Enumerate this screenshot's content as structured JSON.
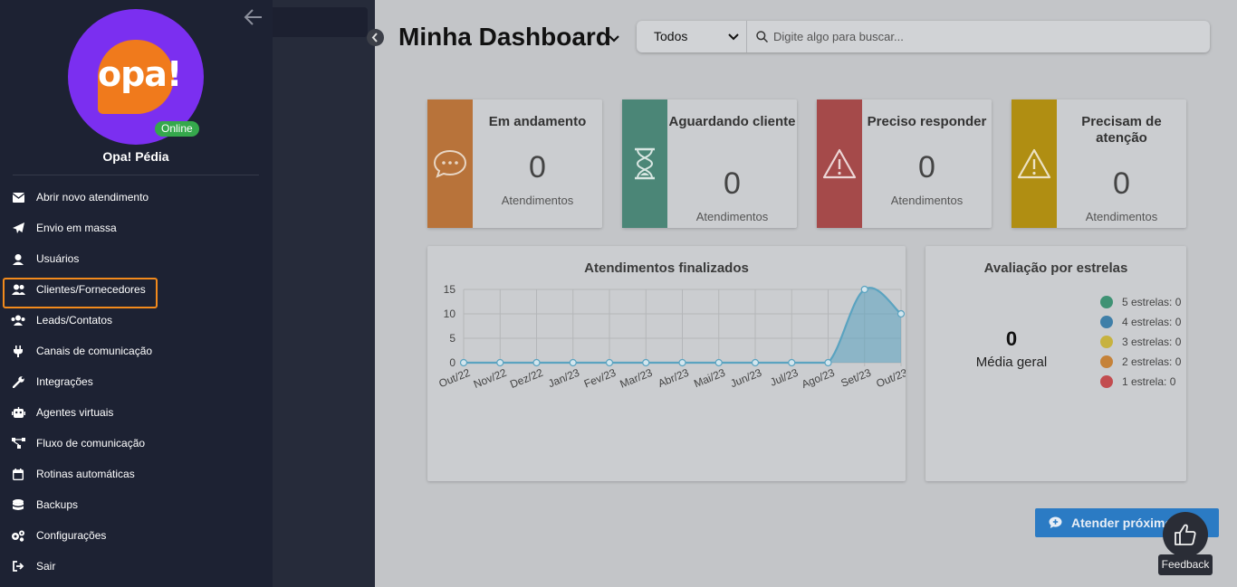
{
  "sidebar": {
    "user_name": "Opa! Pédia",
    "status": "Online",
    "logo_text": "opa!",
    "items": [
      {
        "label": "Abrir novo atendimento",
        "icon": "envelope-icon"
      },
      {
        "label": "Envio em massa",
        "icon": "paper-plane-icon"
      },
      {
        "label": "Usuários",
        "icon": "user-headset-icon"
      },
      {
        "label": "Clientes/Fornecedores",
        "icon": "users-icon",
        "selected": true
      },
      {
        "label": "Leads/Contatos",
        "icon": "user-group-icon"
      },
      {
        "label": "Canais de comunicação",
        "icon": "plug-icon"
      },
      {
        "label": "Integrações",
        "icon": "wrench-icon"
      },
      {
        "label": "Agentes virtuais",
        "icon": "robot-icon"
      },
      {
        "label": "Fluxo de comunicação",
        "icon": "flow-icon"
      },
      {
        "label": "Rotinas automáticas",
        "icon": "calendar-icon"
      },
      {
        "label": "Backups",
        "icon": "database-icon"
      },
      {
        "label": "Configurações",
        "icon": "gears-icon"
      },
      {
        "label": "Sair",
        "icon": "sign-out-icon"
      }
    ]
  },
  "header": {
    "title": "Minha Dashboard",
    "filter_value": "Todos",
    "search_placeholder": "Digite algo para buscar..."
  },
  "cards": [
    {
      "title": "Em andamento",
      "value": "0",
      "label": "Atendimentos",
      "color": "#b8733a",
      "icon": "chat-bubble-icon"
    },
    {
      "title": "Aguardando cliente",
      "value": "0",
      "label": "Atendimentos",
      "color": "#4b8677",
      "icon": "hourglass-icon"
    },
    {
      "title": "Preciso responder",
      "value": "0",
      "label": "Atendimentos",
      "color": "#a54a4a",
      "icon": "warning-icon"
    },
    {
      "title": "Precisam de atenção",
      "value": "0",
      "label": "Atendimentos",
      "color": "#b08e12",
      "icon": "warning-icon"
    }
  ],
  "chart_data": {
    "type": "area",
    "title": "Atendimentos finalizados",
    "categories": [
      "Out/22",
      "Nov/22",
      "Dez/22",
      "Jan/23",
      "Fev/23",
      "Mar/23",
      "Abr/23",
      "Mai/23",
      "Jun/23",
      "Jul/23",
      "Ago/23",
      "Set/23",
      "Out/23"
    ],
    "values": [
      0,
      0,
      0,
      0,
      0,
      0,
      0,
      0,
      0,
      0,
      0,
      15,
      10
    ],
    "ylim": [
      0,
      15
    ],
    "yticks": [
      0,
      5,
      10,
      15
    ],
    "grid": true,
    "color": "#5aa3c0"
  },
  "ratings": {
    "title": "Avaliação por estrelas",
    "average_value": "0",
    "average_label": "Média geral",
    "items": [
      {
        "label": "5 estrelas: 0",
        "color": "#3f9274"
      },
      {
        "label": "4 estrelas: 0",
        "color": "#3f7fa8"
      },
      {
        "label": "3 estrelas: 0",
        "color": "#c7b23f"
      },
      {
        "label": "2 estrelas: 0",
        "color": "#c58239"
      },
      {
        "label": "1 estrela: 0",
        "color": "#c24c4f"
      }
    ]
  },
  "actions": {
    "attend_label": "Atender próximo",
    "feedback_label": "Feedback"
  }
}
